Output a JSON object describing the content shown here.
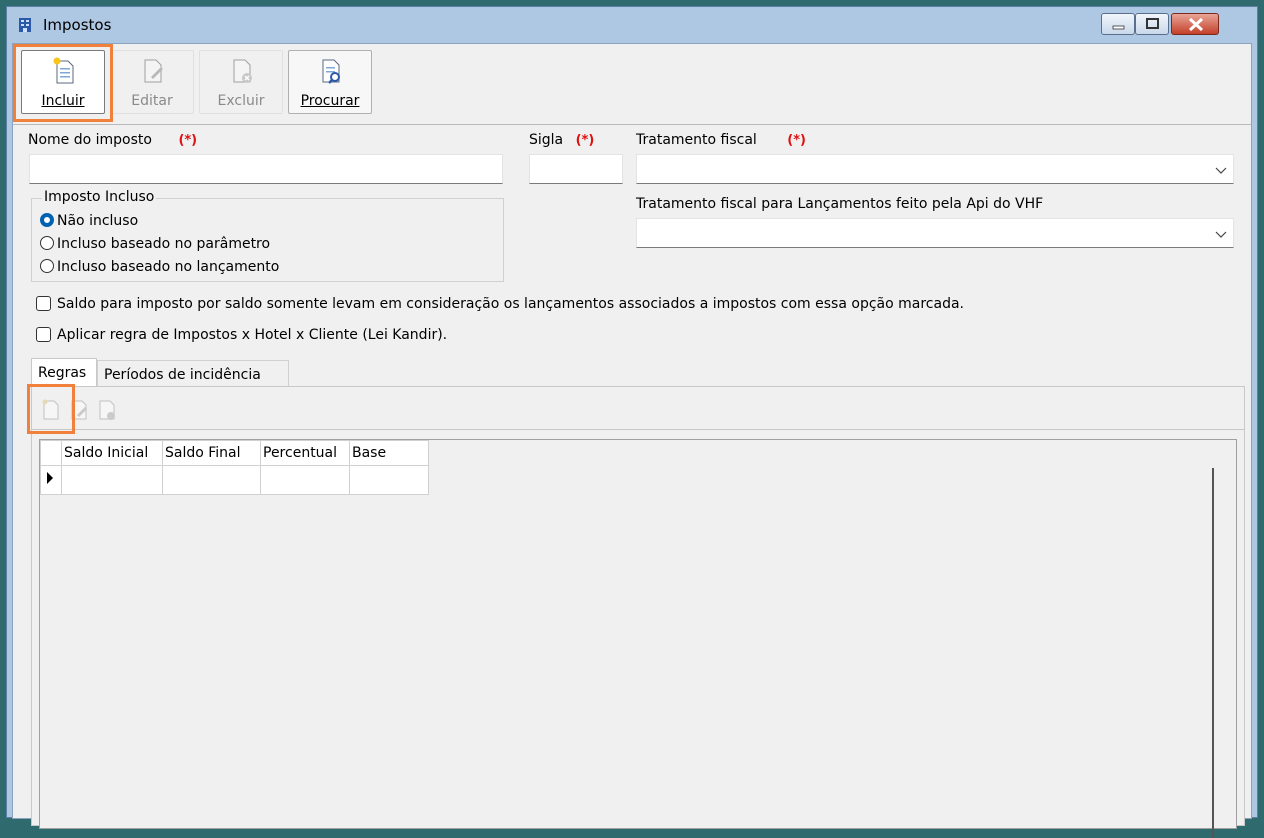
{
  "window": {
    "title": "Impostos",
    "icon": "building-icon",
    "controls": [
      "minimize-icon",
      "maximize-icon",
      "close-icon"
    ]
  },
  "toolbar": {
    "incluir": "Incluir",
    "editar": "Editar",
    "excluir": "Excluir",
    "procurar": "Procurar"
  },
  "form": {
    "nome_label": "Nome do imposto",
    "sigla_label": "Sigla",
    "tratamento_label": "Tratamento fiscal",
    "required_mark": "(*)",
    "tratamento_api_label": "Tratamento fiscal para Lançamentos feito pela Api do VHF",
    "nome_value": "",
    "sigla_value": "",
    "tratamento_value": "",
    "tratamento_api_value": ""
  },
  "imposto_incluso": {
    "legend": "Imposto Incluso",
    "options": [
      "Não incluso",
      "Incluso baseado no parâmetro",
      "Incluso baseado no lançamento"
    ],
    "selected": "Não incluso"
  },
  "checks": {
    "saldo": "Saldo para imposto por saldo somente levam em consideração os lançamentos associados a impostos com essa opção marcada.",
    "lei_kandir": "Aplicar regra de Impostos x Hotel x Cliente (Lei Kandir)."
  },
  "tabs": [
    "Regras",
    "Períodos de incidência"
  ],
  "grid": {
    "columns": [
      "Saldo Inicial",
      "Saldo Final",
      "Percentual",
      "Base"
    ]
  },
  "colors": {
    "highlight": "#f0803c",
    "required": "#e01010",
    "radio_selected": "#0063b1",
    "desktop": "#2f6b6e"
  }
}
